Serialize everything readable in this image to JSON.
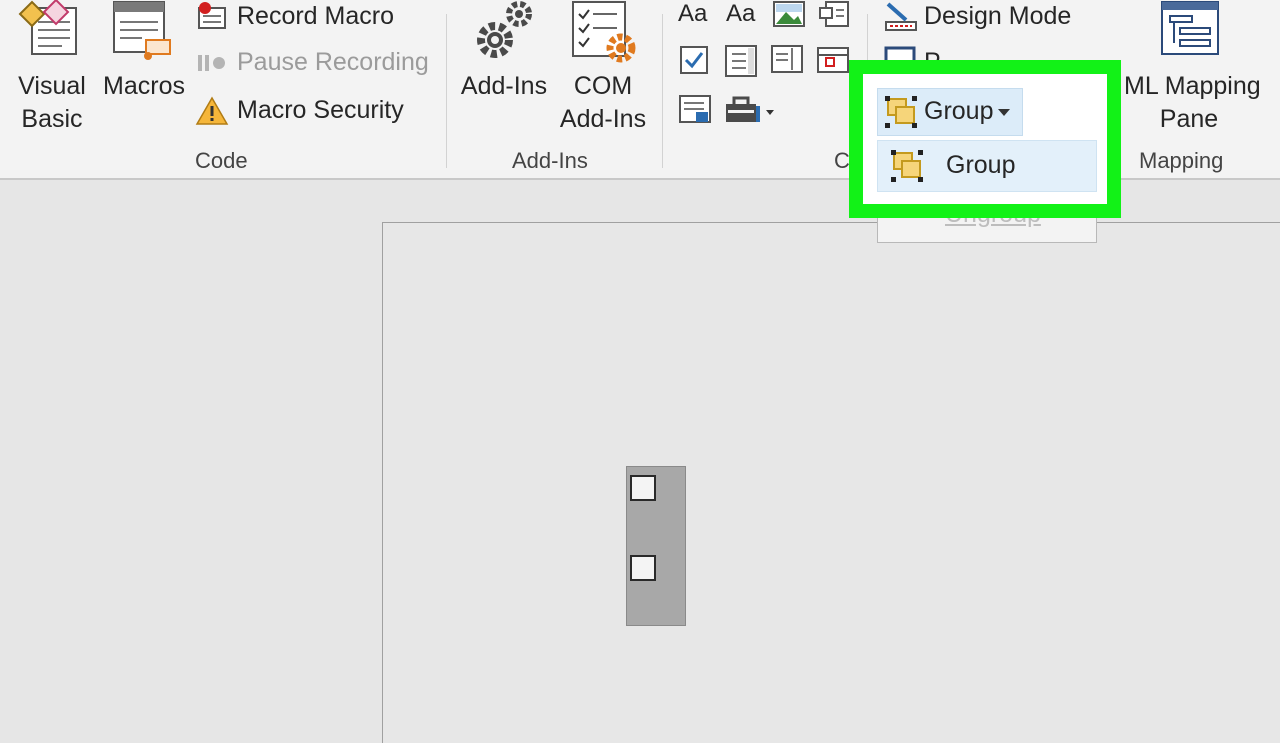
{
  "ribbon": {
    "code": {
      "group_label": "Code",
      "visual_basic_line1": "Visual",
      "visual_basic_line2": "Basic",
      "macros": "Macros",
      "record_macro": "Record Macro",
      "pause_recording": "Pause Recording",
      "macro_security": "Macro Security"
    },
    "addins": {
      "group_label": "Add-Ins",
      "addins": "Add-Ins",
      "com_line1": "COM",
      "com_line2": "Add-Ins"
    },
    "controls": {
      "group_label_partial": "C",
      "design_mode": "Design Mode",
      "properties_partial": "P"
    },
    "mapping": {
      "group_label": "Mapping",
      "xml_line1": "ML Mapping",
      "xml_line2": "Pane"
    }
  },
  "dropdown": {
    "group_button": "Group",
    "menu_group": "Group",
    "menu_ungroup": "Ungroup"
  },
  "colors": {
    "highlight": "#12f217",
    "accent_blue": "#2b6cb0"
  }
}
